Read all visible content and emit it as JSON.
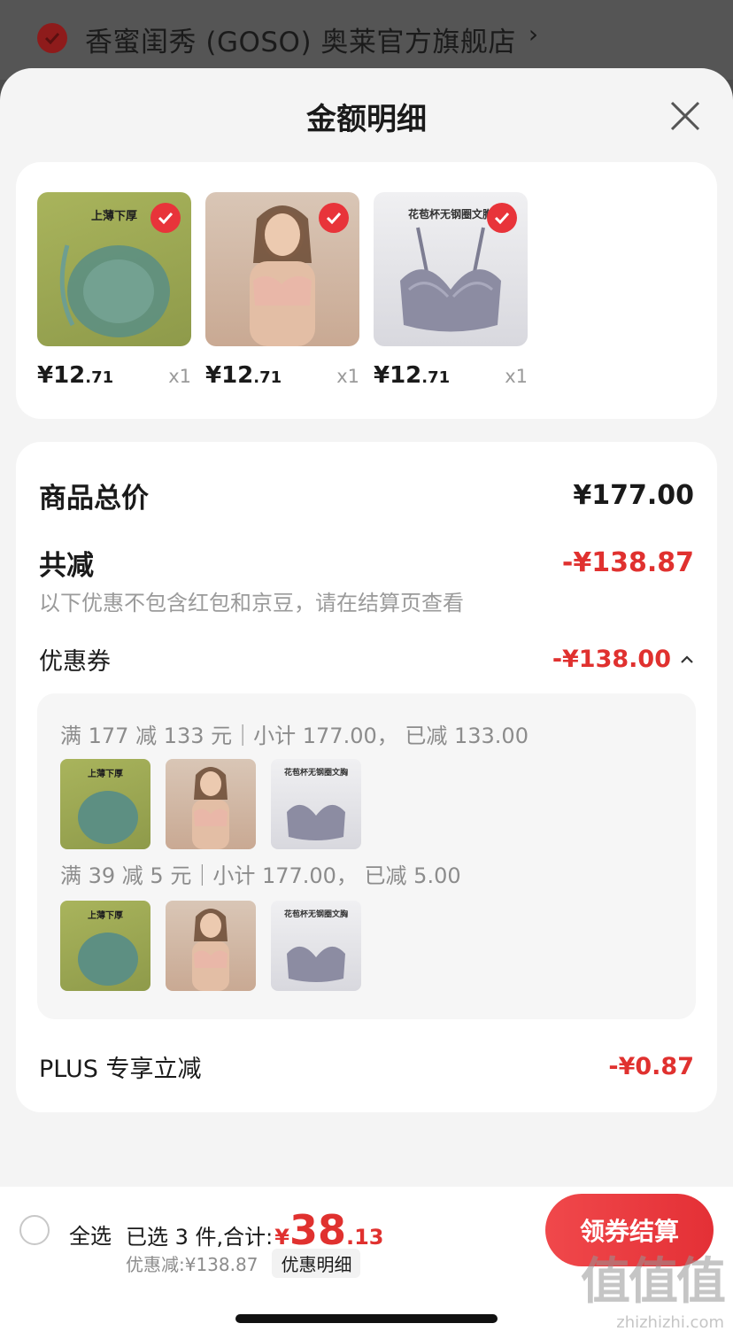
{
  "store": {
    "name": "香蜜闺秀 (GOSO) 奥莱官方旗舰店",
    "chevron": "›"
  },
  "sheet": {
    "title": "金额明细"
  },
  "products": [
    {
      "tag": "上薄下厚",
      "price_int": "¥12",
      "price_dec": ".71",
      "qty": "x1",
      "image": "green-lace-bra"
    },
    {
      "tag": "",
      "price_int": "¥12",
      "price_dec": ".71",
      "qty": "x1",
      "image": "model-pink-bra"
    },
    {
      "tag": "花苞杯无钢圈文胸",
      "price_int": "¥12",
      "price_dec": ".71",
      "qty": "x1",
      "image": "gray-lace-bra"
    }
  ],
  "summary": {
    "total_label": "商品总价",
    "total_value": "¥177.00",
    "reduce_label": "共减",
    "reduce_value": "-¥138.87",
    "hint": "以下优惠不包含红包和京豆，请在结算页查看",
    "coupon_label": "优惠券",
    "coupon_value": "-¥138.00",
    "coupon_lines": [
      "满 177 减 133 元｜小计 177.00， 已减 133.00",
      "满 39 减 5 元｜小计 177.00， 已减 5.00"
    ],
    "thumb_tags": [
      "上薄下厚",
      "",
      "花苞杯无钢圈文胸"
    ],
    "plus_label": "PLUS 专享立减",
    "plus_value": "-¥0.87"
  },
  "bottom": {
    "select_all": "全选",
    "selected_prefix": "已选 3 件,合计:",
    "total_yen": "¥",
    "total_int": "38",
    "total_dec": ".13",
    "discount": "优惠减:¥138.87",
    "detail_chip": "优惠明细",
    "checkout": "领券结算"
  },
  "watermark": {
    "big": "值值值",
    "small": "zhizhizhi.com"
  },
  "colors": {
    "accent_red": "#e0312f",
    "check_red": "#e8343a"
  }
}
